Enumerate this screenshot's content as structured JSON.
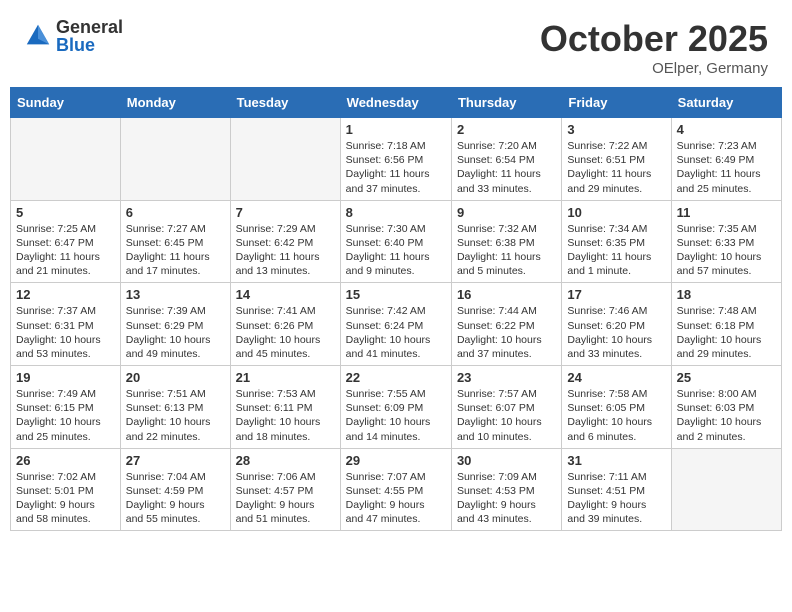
{
  "header": {
    "logo_general": "General",
    "logo_blue": "Blue",
    "month": "October 2025",
    "location": "OElper, Germany"
  },
  "weekdays": [
    "Sunday",
    "Monday",
    "Tuesday",
    "Wednesday",
    "Thursday",
    "Friday",
    "Saturday"
  ],
  "weeks": [
    [
      {
        "day": "",
        "info": ""
      },
      {
        "day": "",
        "info": ""
      },
      {
        "day": "",
        "info": ""
      },
      {
        "day": "1",
        "info": "Sunrise: 7:18 AM\nSunset: 6:56 PM\nDaylight: 11 hours\nand 37 minutes."
      },
      {
        "day": "2",
        "info": "Sunrise: 7:20 AM\nSunset: 6:54 PM\nDaylight: 11 hours\nand 33 minutes."
      },
      {
        "day": "3",
        "info": "Sunrise: 7:22 AM\nSunset: 6:51 PM\nDaylight: 11 hours\nand 29 minutes."
      },
      {
        "day": "4",
        "info": "Sunrise: 7:23 AM\nSunset: 6:49 PM\nDaylight: 11 hours\nand 25 minutes."
      }
    ],
    [
      {
        "day": "5",
        "info": "Sunrise: 7:25 AM\nSunset: 6:47 PM\nDaylight: 11 hours\nand 21 minutes."
      },
      {
        "day": "6",
        "info": "Sunrise: 7:27 AM\nSunset: 6:45 PM\nDaylight: 11 hours\nand 17 minutes."
      },
      {
        "day": "7",
        "info": "Sunrise: 7:29 AM\nSunset: 6:42 PM\nDaylight: 11 hours\nand 13 minutes."
      },
      {
        "day": "8",
        "info": "Sunrise: 7:30 AM\nSunset: 6:40 PM\nDaylight: 11 hours\nand 9 minutes."
      },
      {
        "day": "9",
        "info": "Sunrise: 7:32 AM\nSunset: 6:38 PM\nDaylight: 11 hours\nand 5 minutes."
      },
      {
        "day": "10",
        "info": "Sunrise: 7:34 AM\nSunset: 6:35 PM\nDaylight: 11 hours\nand 1 minute."
      },
      {
        "day": "11",
        "info": "Sunrise: 7:35 AM\nSunset: 6:33 PM\nDaylight: 10 hours\nand 57 minutes."
      }
    ],
    [
      {
        "day": "12",
        "info": "Sunrise: 7:37 AM\nSunset: 6:31 PM\nDaylight: 10 hours\nand 53 minutes."
      },
      {
        "day": "13",
        "info": "Sunrise: 7:39 AM\nSunset: 6:29 PM\nDaylight: 10 hours\nand 49 minutes."
      },
      {
        "day": "14",
        "info": "Sunrise: 7:41 AM\nSunset: 6:26 PM\nDaylight: 10 hours\nand 45 minutes."
      },
      {
        "day": "15",
        "info": "Sunrise: 7:42 AM\nSunset: 6:24 PM\nDaylight: 10 hours\nand 41 minutes."
      },
      {
        "day": "16",
        "info": "Sunrise: 7:44 AM\nSunset: 6:22 PM\nDaylight: 10 hours\nand 37 minutes."
      },
      {
        "day": "17",
        "info": "Sunrise: 7:46 AM\nSunset: 6:20 PM\nDaylight: 10 hours\nand 33 minutes."
      },
      {
        "day": "18",
        "info": "Sunrise: 7:48 AM\nSunset: 6:18 PM\nDaylight: 10 hours\nand 29 minutes."
      }
    ],
    [
      {
        "day": "19",
        "info": "Sunrise: 7:49 AM\nSunset: 6:15 PM\nDaylight: 10 hours\nand 25 minutes."
      },
      {
        "day": "20",
        "info": "Sunrise: 7:51 AM\nSunset: 6:13 PM\nDaylight: 10 hours\nand 22 minutes."
      },
      {
        "day": "21",
        "info": "Sunrise: 7:53 AM\nSunset: 6:11 PM\nDaylight: 10 hours\nand 18 minutes."
      },
      {
        "day": "22",
        "info": "Sunrise: 7:55 AM\nSunset: 6:09 PM\nDaylight: 10 hours\nand 14 minutes."
      },
      {
        "day": "23",
        "info": "Sunrise: 7:57 AM\nSunset: 6:07 PM\nDaylight: 10 hours\nand 10 minutes."
      },
      {
        "day": "24",
        "info": "Sunrise: 7:58 AM\nSunset: 6:05 PM\nDaylight: 10 hours\nand 6 minutes."
      },
      {
        "day": "25",
        "info": "Sunrise: 8:00 AM\nSunset: 6:03 PM\nDaylight: 10 hours\nand 2 minutes."
      }
    ],
    [
      {
        "day": "26",
        "info": "Sunrise: 7:02 AM\nSunset: 5:01 PM\nDaylight: 9 hours\nand 58 minutes."
      },
      {
        "day": "27",
        "info": "Sunrise: 7:04 AM\nSunset: 4:59 PM\nDaylight: 9 hours\nand 55 minutes."
      },
      {
        "day": "28",
        "info": "Sunrise: 7:06 AM\nSunset: 4:57 PM\nDaylight: 9 hours\nand 51 minutes."
      },
      {
        "day": "29",
        "info": "Sunrise: 7:07 AM\nSunset: 4:55 PM\nDaylight: 9 hours\nand 47 minutes."
      },
      {
        "day": "30",
        "info": "Sunrise: 7:09 AM\nSunset: 4:53 PM\nDaylight: 9 hours\nand 43 minutes."
      },
      {
        "day": "31",
        "info": "Sunrise: 7:11 AM\nSunset: 4:51 PM\nDaylight: 9 hours\nand 39 minutes."
      },
      {
        "day": "",
        "info": ""
      }
    ]
  ]
}
